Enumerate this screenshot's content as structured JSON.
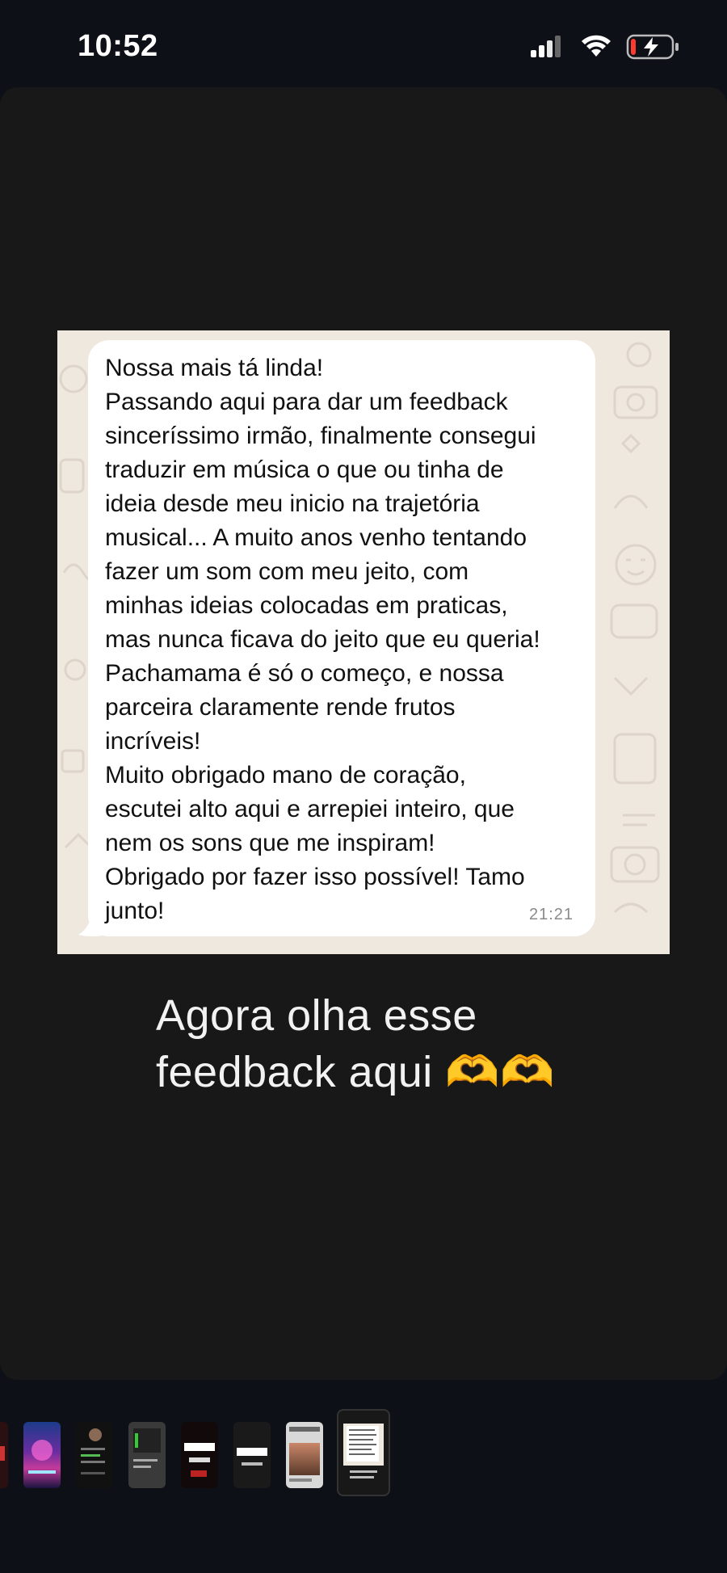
{
  "status_bar": {
    "time": "10:52",
    "signal_icon": "cellular-signal-icon",
    "wifi_icon": "wifi-icon",
    "battery_icon": "battery-charging-low-icon",
    "battery_level_fraction": 0.12
  },
  "message": {
    "lines": [
      "Nossa mais tá linda!",
      "Passando aqui para dar um feedback",
      "sinceríssimo irmão, finalmente consegui",
      "traduzir em música o que ou tinha de",
      "ideia desde meu inicio na trajetória",
      "musical... A muito anos venho tentando",
      "fazer um som com meu jeito, com",
      "minhas ideias colocadas em praticas,",
      "mas nunca ficava do jeito que eu queria!",
      "Pachamama é só o começo, e nossa",
      "parceira claramente rende frutos",
      "incríveis!",
      "Muito obrigado mano de coração,",
      "escutei alto aqui e arrepiei inteiro, que",
      "nem os sons que me inspiram!",
      "Obrigado por fazer isso possível! Tamo",
      "junto!"
    ],
    "time": "21:21"
  },
  "caption": {
    "line1": "Agora olha esse",
    "line2": "feedback aqui 🫶🫶"
  },
  "thumbnails": [
    {
      "name": "thumb-partial-left"
    },
    {
      "name": "thumb-neon-poster"
    },
    {
      "name": "thumb-dark-profile"
    },
    {
      "name": "thumb-chat-gray"
    },
    {
      "name": "thumb-dark-text-red"
    },
    {
      "name": "thumb-dark-text"
    },
    {
      "name": "thumb-photo-person"
    },
    {
      "name": "thumb-current-selected",
      "selected": true
    }
  ],
  "colors": {
    "background": "#0d1117",
    "canvas": "#181818",
    "chat_wallpaper": "#eee8df",
    "bubble": "#ffffff",
    "battery_low": "#ff3b30"
  }
}
